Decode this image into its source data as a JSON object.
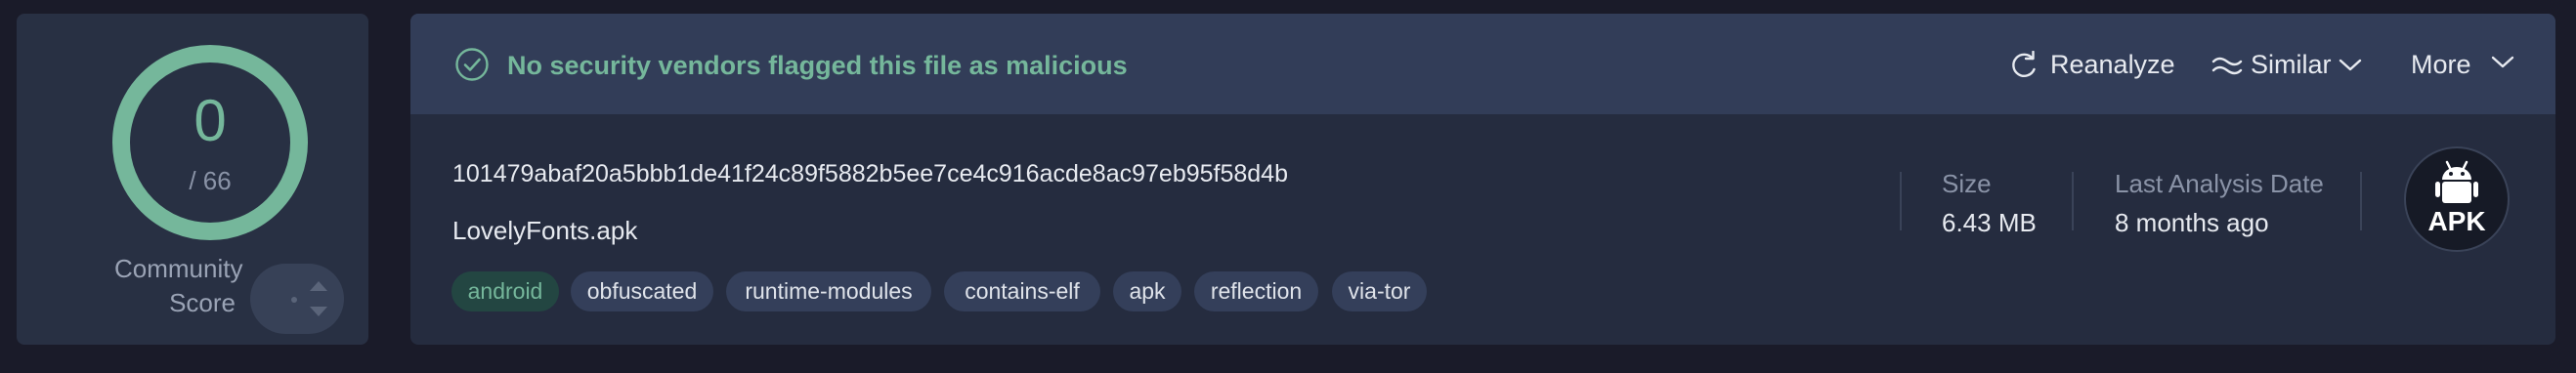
{
  "score": {
    "detections": "0",
    "total": "/ 66",
    "community_label": "Community Score",
    "ring_color": "#75b79b"
  },
  "banner": {
    "message": "No security vendors flagged this file as malicious",
    "status_color": "#75b79b",
    "check_icon": "check-circle-icon"
  },
  "actions": {
    "reanalyze": "Reanalyze",
    "similar": "Similar",
    "more": "More"
  },
  "file": {
    "hash": "101479abaf20a5bbb1de41f24c89f5882b5ee7ce4c916acde8ac97eb95f58d4b",
    "name": "LovelyFonts.apk",
    "tags": [
      "android",
      "obfuscated",
      "runtime-modules",
      "contains-elf",
      "apk",
      "reflection",
      "via-tor"
    ]
  },
  "meta": {
    "size_label": "Size",
    "size_value": "6.43 MB",
    "date_label": "Last Analysis Date",
    "date_value": "8 months ago"
  },
  "filetype": {
    "label": "APK",
    "icon": "android-icon"
  }
}
